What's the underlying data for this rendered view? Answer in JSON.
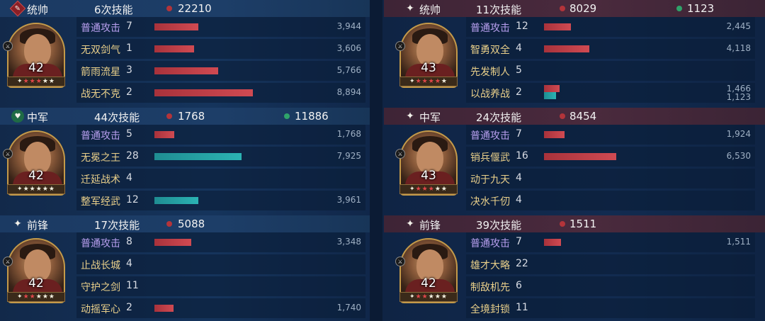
{
  "left": [
    {
      "position": {
        "label": "统帅",
        "icon": "commander-icon",
        "icon_color": "#8a1f26"
      },
      "casts": "6次技能",
      "damage": "22210",
      "heal": null,
      "general": {
        "level": "42",
        "stars": 5,
        "red_stars": 3,
        "portrait": "warrior-red-headband-portrait"
      },
      "skills": [
        {
          "name": "普通攻击",
          "count": "7",
          "value": "3,944",
          "bar_ratio": 0.44,
          "bar_color": "red",
          "basic": true
        },
        {
          "name": "无双剑气",
          "count": "1",
          "value": "3,606",
          "bar_ratio": 0.4,
          "bar_color": "red"
        },
        {
          "name": "箭雨流星",
          "count": "3",
          "value": "5,766",
          "bar_ratio": 0.64,
          "bar_color": "red"
        },
        {
          "name": "战无不克",
          "count": "2",
          "value": "8,894",
          "bar_ratio": 0.99,
          "bar_color": "red"
        }
      ]
    },
    {
      "position": {
        "label": "中军",
        "icon": "middle-army-icon",
        "icon_color": "#1f6b45"
      },
      "casts": "44次技能",
      "damage": "1768",
      "heal": "11886",
      "general": {
        "level": "42",
        "stars": 5,
        "red_stars": 0,
        "portrait": "king-golden-crown-portrait"
      },
      "skills": [
        {
          "name": "普通攻击",
          "count": "5",
          "value": "1,768",
          "bar_ratio": 0.2,
          "bar_color": "red",
          "basic": true
        },
        {
          "name": "无冕之王",
          "count": "28",
          "value": "7,925",
          "bar_ratio": 0.88,
          "bar_color": "teal"
        },
        {
          "name": "迁延战术",
          "count": "4",
          "value": "",
          "bar_ratio": 0,
          "bar_color": "red"
        },
        {
          "name": "整军经武",
          "count": "12",
          "value": "3,961",
          "bar_ratio": 0.44,
          "bar_color": "teal"
        }
      ]
    },
    {
      "position": {
        "label": "前锋",
        "icon": "vanguard-icon",
        "icon_color": "#ffffff"
      },
      "casts": "17次技能",
      "damage": "5088",
      "heal": null,
      "general": {
        "level": "42",
        "stars": 5,
        "red_stars": 2,
        "portrait": "warrior-red-armor-portrait"
      },
      "skills": [
        {
          "name": "普通攻击",
          "count": "8",
          "value": "3,348",
          "bar_ratio": 0.37,
          "bar_color": "red",
          "basic": true
        },
        {
          "name": "止战长城",
          "count": "4",
          "value": "",
          "bar_ratio": 0,
          "bar_color": "red"
        },
        {
          "name": "守护之剑",
          "count": "11",
          "value": "",
          "bar_ratio": 0,
          "bar_color": "red"
        },
        {
          "name": "动摇军心",
          "count": "2",
          "value": "1,740",
          "bar_ratio": 0.19,
          "bar_color": "red"
        }
      ]
    }
  ],
  "right": [
    {
      "position": {
        "label": "统帅",
        "icon": "commander-icon",
        "icon_color": "#ffffff"
      },
      "casts": "11次技能",
      "damage": "8029",
      "heal": "1123",
      "general": {
        "level": "43",
        "stars": 5,
        "red_stars": 4,
        "portrait": "female-warrior-golden-helmet-portrait"
      },
      "skills": [
        {
          "name": "普通攻击",
          "count": "12",
          "value": "2,445",
          "bar_ratio": 0.27,
          "bar_color": "red",
          "basic": true
        },
        {
          "name": "智勇双全",
          "count": "4",
          "value": "4,118",
          "bar_ratio": 0.46,
          "bar_color": "red"
        },
        {
          "name": "先发制人",
          "count": "5",
          "value": "",
          "bar_ratio": 0,
          "bar_color": "red"
        },
        {
          "name": "以战养战",
          "count": "2",
          "value": "1,466",
          "value2": "1,123",
          "bar_ratio": 0.16,
          "bar_ratio2": 0.12,
          "bar_color": "red",
          "bar_color2": "teal",
          "stacked": true
        }
      ]
    },
    {
      "position": {
        "label": "中军",
        "icon": "middle-army-icon",
        "icon_color": "#ffffff"
      },
      "casts": "24次技能",
      "damage": "8454",
      "heal": null,
      "general": {
        "level": "43",
        "stars": 5,
        "red_stars": 3,
        "portrait": "bearded-general-crown-portrait"
      },
      "skills": [
        {
          "name": "普通攻击",
          "count": "7",
          "value": "1,924",
          "bar_ratio": 0.21,
          "bar_color": "red",
          "basic": true
        },
        {
          "name": "销兵偃武",
          "count": "16",
          "value": "6,530",
          "bar_ratio": 0.73,
          "bar_color": "red"
        },
        {
          "name": "动于九天",
          "count": "4",
          "value": "",
          "bar_ratio": 0,
          "bar_color": "red"
        },
        {
          "name": "决水千仞",
          "count": "4",
          "value": "",
          "bar_ratio": 0,
          "bar_color": "red"
        }
      ]
    },
    {
      "position": {
        "label": "前锋",
        "icon": "vanguard-icon",
        "icon_color": "#ffffff"
      },
      "casts": "39次技能",
      "damage": "1511",
      "heal": null,
      "general": {
        "level": "42",
        "stars": 5,
        "red_stars": 2,
        "portrait": "bearded-lord-portrait"
      },
      "skills": [
        {
          "name": "普通攻击",
          "count": "7",
          "value": "1,511",
          "bar_ratio": 0.17,
          "bar_color": "red",
          "basic": true
        },
        {
          "name": "雄才大略",
          "count": "22",
          "value": "",
          "bar_ratio": 0,
          "bar_color": "red"
        },
        {
          "name": "制敌机先",
          "count": "6",
          "value": "",
          "bar_ratio": 0,
          "bar_color": "red"
        },
        {
          "name": "全境封锁",
          "count": "11",
          "value": "",
          "bar_ratio": 0,
          "bar_color": "red"
        }
      ]
    }
  ]
}
